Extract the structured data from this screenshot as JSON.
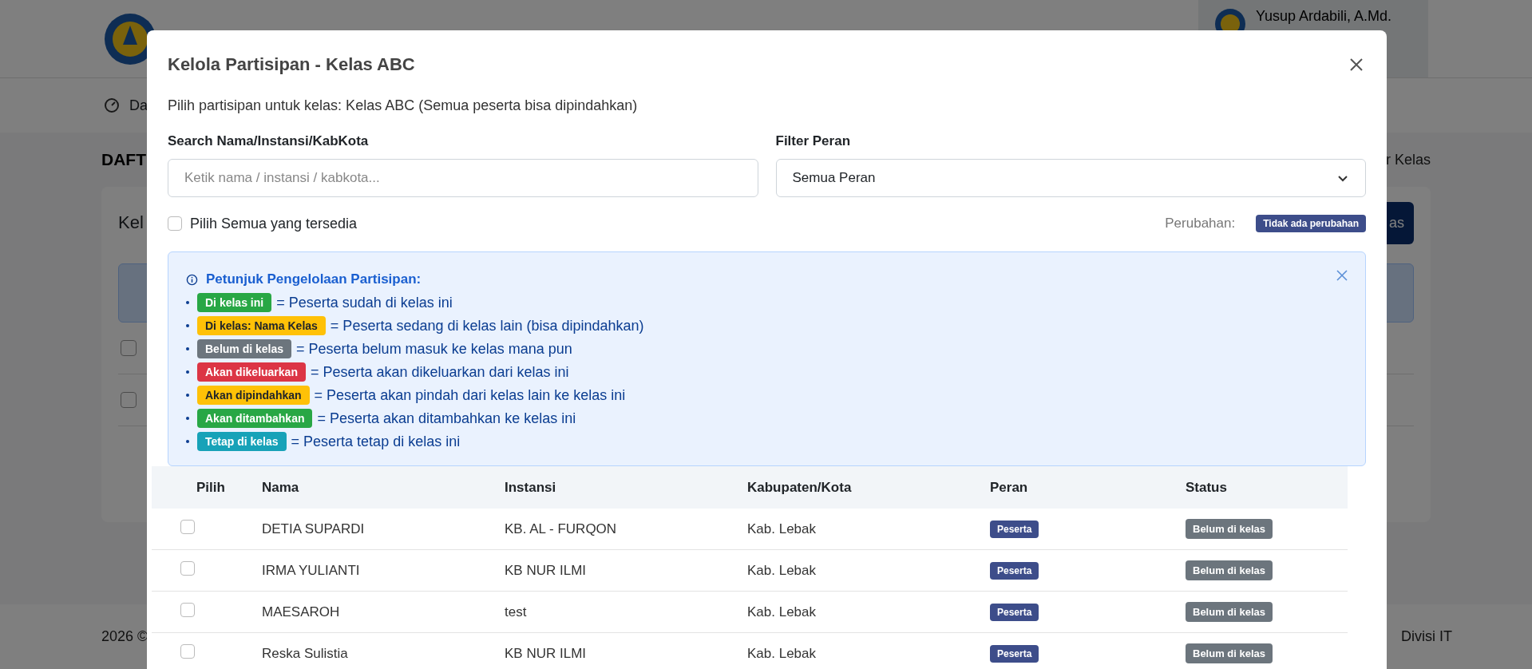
{
  "background_page": {
    "user_name": "Yusup Ardabili, A.Md.",
    "nav_item": "Da",
    "heading": "DAFT",
    "breadcrumb": "r Kelas",
    "card_title": "Kel",
    "card_button": "as",
    "footer_left": "2026 ©",
    "footer_right": "Divisi IT",
    "row_checkboxes": [
      {
        "checked": false
      },
      {
        "checked": false
      }
    ]
  },
  "modal": {
    "title": "Kelola Partisipan - Kelas ABC",
    "subtitle": "Pilih partisipan untuk kelas: Kelas ABC (Semua peserta bisa dipindahkan)",
    "search": {
      "label": "Search Nama/Instansi/KabKota",
      "placeholder": "Ketik nama / instansi / kabkota..."
    },
    "filter": {
      "label": "Filter Peran",
      "value": "Semua Peran"
    },
    "select_all": {
      "label": "Pilih Semua yang tersedia",
      "checked": false
    },
    "changes": {
      "label": "Perubahan:",
      "badge": "Tidak ada perubahan"
    },
    "legend": {
      "title": "Petunjuk Pengelolaan Partisipan:",
      "items": [
        {
          "badge": "Di kelas ini",
          "color": "#28a745",
          "text": "= Peserta sudah di kelas ini"
        },
        {
          "badge": "Di kelas: Nama Kelas",
          "color": "#ffc107",
          "text": "= Peserta sedang di kelas lain (bisa dipindahkan)"
        },
        {
          "badge": "Belum di kelas",
          "color": "#6c757d",
          "text": "= Peserta belum masuk ke kelas mana pun"
        },
        {
          "badge": "Akan dikeluarkan",
          "color": "#dc3545",
          "text": "= Peserta akan dikeluarkan dari kelas ini"
        },
        {
          "badge": "Akan dipindahkan",
          "color": "#ffc107",
          "text": "= Peserta akan pindah dari kelas lain ke kelas ini"
        },
        {
          "badge": "Akan ditambahkan",
          "color": "#28a745",
          "text": "= Peserta akan ditambahkan ke kelas ini"
        },
        {
          "badge": "Tetap di kelas",
          "color": "#17a2b8",
          "text": "= Peserta tetap di kelas ini"
        }
      ]
    },
    "table": {
      "columns": [
        "Pilih",
        "Nama",
        "Instansi",
        "Kabupaten/Kota",
        "Peran",
        "Status"
      ],
      "rows": [
        {
          "selected": false,
          "nama": "DETIA SUPARDI",
          "instansi": "KB. AL - FURQON",
          "kabkota": "Kab. Lebak",
          "peran": "Peserta",
          "status": "Belum di kelas"
        },
        {
          "selected": false,
          "nama": "IRMA YULIANTI",
          "instansi": "KB NUR ILMI",
          "kabkota": "Kab. Lebak",
          "peran": "Peserta",
          "status": "Belum di kelas"
        },
        {
          "selected": false,
          "nama": "MAESAROH",
          "instansi": "test",
          "kabkota": "Kab. Lebak",
          "peran": "Peserta",
          "status": "Belum di kelas"
        },
        {
          "selected": false,
          "nama": "Reska Sulistia",
          "instansi": "KB NUR ILMI",
          "kabkota": "Kab. Lebak",
          "peran": "Peserta",
          "status": "Belum di kelas"
        }
      ]
    }
  }
}
